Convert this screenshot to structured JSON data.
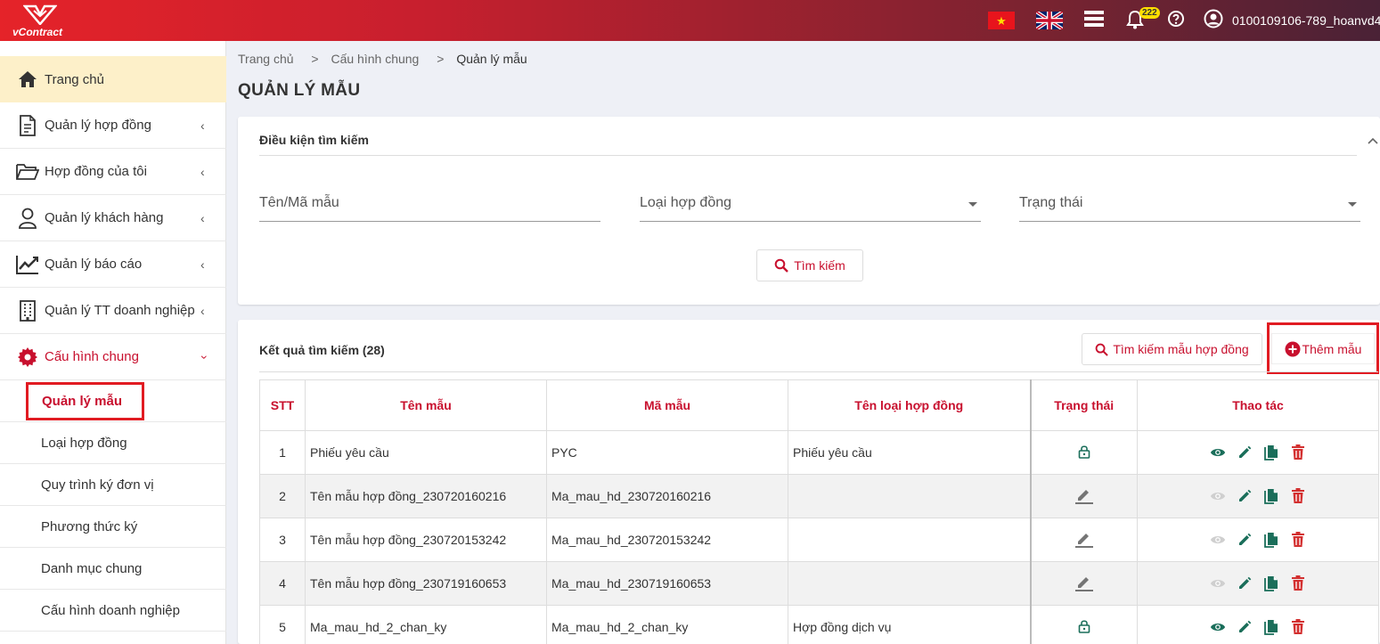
{
  "app": {
    "logo_text": "vContract",
    "user_name": "0100109106-789_hoanvd4",
    "notification_count": "222"
  },
  "sidebar": {
    "home": "Trang chủ",
    "items": [
      {
        "label": "Quản lý hợp đồng",
        "icon": "document-icon"
      },
      {
        "label": "Hợp đồng của tôi",
        "icon": "folder-icon"
      },
      {
        "label": "Quản lý khách hàng",
        "icon": "user-icon"
      },
      {
        "label": "Quản lý báo cáo",
        "icon": "chart-icon"
      },
      {
        "label": "Quản lý TT doanh nghiệp",
        "icon": "building-icon"
      },
      {
        "label": "Cấu hình chung",
        "icon": "gear-icon"
      }
    ],
    "sub_items": [
      "Quản lý mẫu",
      "Loại hợp đồng",
      "Quy trình ký đơn vị",
      "Phương thức ký",
      "Danh mục chung",
      "Cấu hình doanh nghiệp"
    ]
  },
  "breadcrumb": {
    "home": "Trang chủ",
    "sep": ">",
    "parent": "Cấu hình chung",
    "current": "Quản lý mẫu"
  },
  "page_title": "QUẢN LÝ MẪU",
  "search": {
    "title": "Điều kiện tìm kiếm",
    "name_placeholder": "Tên/Mã mẫu",
    "type_placeholder": "Loại hợp đồng",
    "status_placeholder": "Trạng thái",
    "button": "Tìm kiếm"
  },
  "results": {
    "title": "Kết quả tìm kiếm (28)",
    "search_template_button": "Tìm kiếm mẫu hợp đồng",
    "add_button": "Thêm mẫu",
    "columns": [
      "STT",
      "Tên mẫu",
      "Mã mẫu",
      "Tên loại hợp đồng",
      "Trạng thái",
      "Thao tác"
    ],
    "rows": [
      {
        "stt": "1",
        "name": "Phiếu yêu cầu",
        "code": "PYC",
        "type": "Phiếu yêu cầu",
        "status": "locked"
      },
      {
        "stt": "2",
        "name": "Tên mẫu hợp đồng_230720160216",
        "code": "Ma_mau_hd_230720160216",
        "type": "",
        "status": "draft"
      },
      {
        "stt": "3",
        "name": "Tên mẫu hợp đồng_230720153242",
        "code": "Ma_mau_hd_230720153242",
        "type": "",
        "status": "draft"
      },
      {
        "stt": "4",
        "name": "Tên mẫu hợp đồng_230719160653",
        "code": "Ma_mau_hd_230719160653",
        "type": "",
        "status": "draft"
      },
      {
        "stt": "5",
        "name": "Ma_mau_hd_2_chan_ky",
        "code": "Ma_mau_hd_2_chan_ky",
        "type": "Hợp đồng dịch vụ",
        "status": "locked"
      }
    ]
  },
  "colors": {
    "brand_red": "#c8102e",
    "accent_green": "#1a6e5a",
    "highlight": "#e11b22"
  }
}
